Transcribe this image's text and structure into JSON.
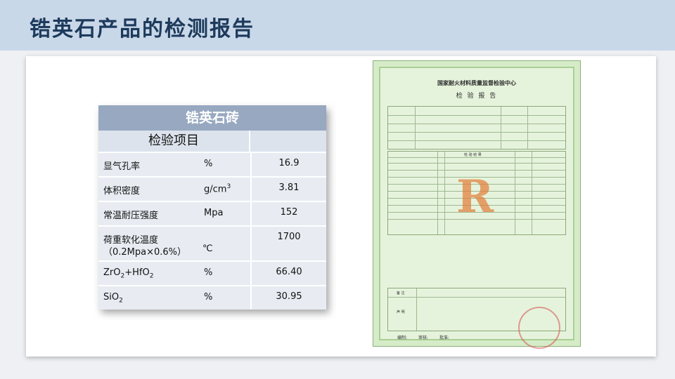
{
  "page": {
    "title": "锆英石产品的检测报告"
  },
  "table": {
    "title": "锆英石砖",
    "header": "检验项目",
    "rows": [
      {
        "name": "显气孔率",
        "unit": "%",
        "value": "16.9"
      },
      {
        "name": "体积密度",
        "unit": "g/cm",
        "unit_sup": "3",
        "value": "3.81"
      },
      {
        "name": "常温耐压强度",
        "unit": "Mpa",
        "value": "152"
      },
      {
        "name": "荷重软化温度",
        "name_line2": "（0.2Mpa×0.6%）",
        "unit": "℃",
        "value": "1700"
      },
      {
        "name_main": "ZrO",
        "name_sub": "2",
        "name_plus": "+HfO",
        "name_sub2": "2",
        "unit": "%",
        "value": "66.40"
      },
      {
        "name_main": "SiO",
        "name_sub": "2",
        "unit": "%",
        "value": "30.95"
      }
    ]
  },
  "certificate": {
    "center": "国家耐火材料质量监督检验中心",
    "title": "检 验 报 告",
    "watermark": "R",
    "section_result": "检 验 结 果",
    "section_remark": "备 注",
    "section_statement": "声 明",
    "signers": [
      "编制:",
      "审核:",
      "批准:"
    ]
  },
  "colors": {
    "header_bg": "#c9d8e8",
    "title_color": "#1d3a5c",
    "table_title_bg": "#97a8c0",
    "table_row_bg": "#e8ecf2",
    "cert_bg": "#d6ecc8",
    "watermark": "#e27e3a"
  }
}
